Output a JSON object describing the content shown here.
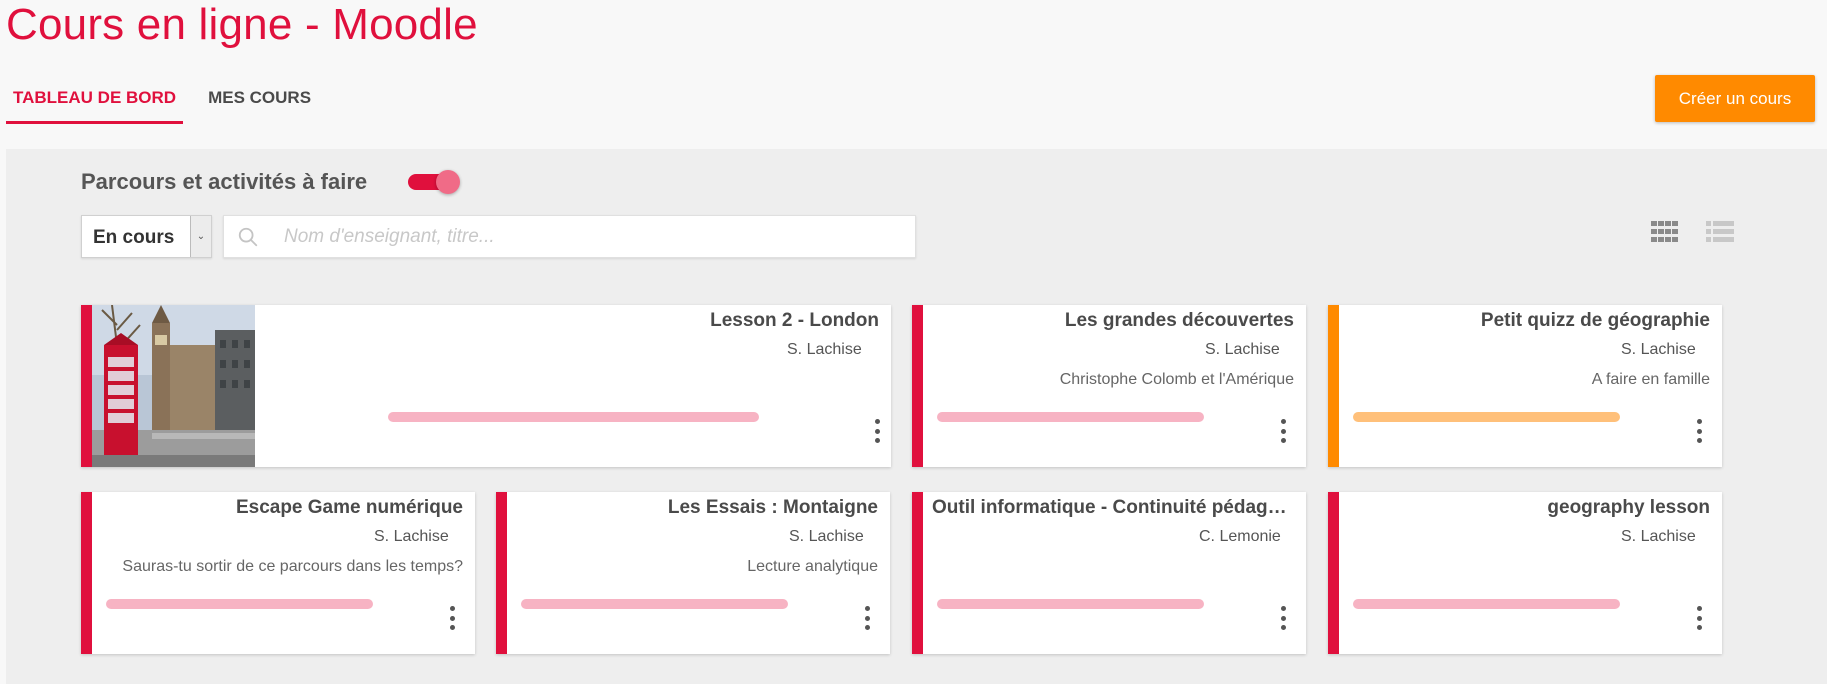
{
  "app": {
    "title": "Cours en ligne - Moodle"
  },
  "tabs": [
    {
      "label": "TABLEAU DE BORD",
      "active": true
    },
    {
      "label": "MES COURS",
      "active": false
    }
  ],
  "create_button": {
    "label": "Créer un cours"
  },
  "section": {
    "title": "Parcours et activités à faire",
    "toggle_on": true
  },
  "filter": {
    "status_value": "En cours",
    "search_placeholder": "Nom d'enseignant, titre..."
  },
  "view_modes": {
    "grid_icon": "grid-view-icon",
    "list_icon": "list-view-icon",
    "active": "grid"
  },
  "colors": {
    "brand": "#e0103d",
    "orange": "#ff8a00",
    "pink_progress": "#f7b3c3",
    "orange_progress": "#ffc07a"
  },
  "cards": [
    {
      "title": "Lesson 2 - London",
      "author": "S. Lachise",
      "description": "",
      "accent": "#e0103d",
      "has_image": true,
      "image_alt": "London - Big Ben and red phone box"
    },
    {
      "title": "Les grandes découvertes",
      "author": "S. Lachise",
      "description": "Christophe Colomb et l'Amérique",
      "accent": "#e0103d"
    },
    {
      "title": "Petit quizz de géographie",
      "author": "S. Lachise",
      "description": "A faire en famille",
      "accent": "#ff8a00"
    },
    {
      "title": "Escape Game numérique",
      "author": "S. Lachise",
      "description": "Sauras-tu sortir de ce parcours dans les temps?",
      "accent": "#e0103d"
    },
    {
      "title": "Les Essais : Montaigne",
      "author": "S. Lachise",
      "description": "Lecture analytique",
      "accent": "#e0103d"
    },
    {
      "title": "Outil informatique - Continuité pédago...",
      "author": "C. Lemonie",
      "description": "",
      "accent": "#e0103d"
    },
    {
      "title": "geography lesson",
      "author": "S. Lachise",
      "description": "",
      "accent": "#e0103d"
    }
  ]
}
